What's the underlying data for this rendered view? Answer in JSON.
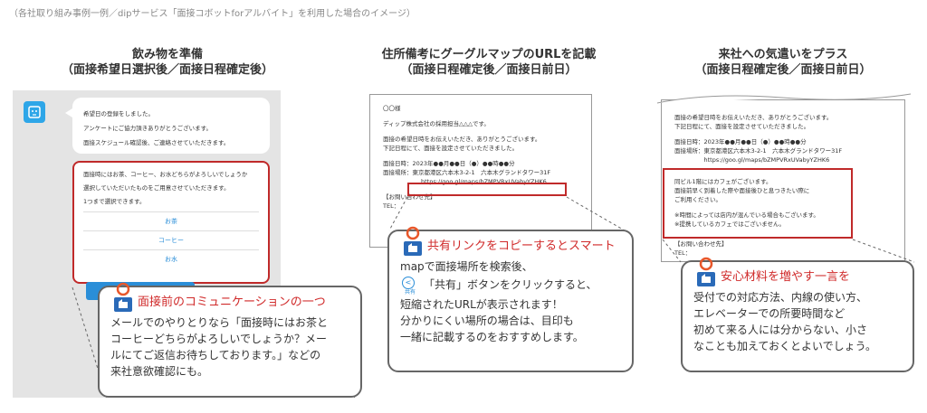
{
  "caption": "（各社取り組み事例一例／dipサービス「面接コボットforアルバイト」を利用した場合のイメージ）",
  "sections": [
    {
      "title1": "飲み物を準備",
      "title2": "（面接希望日選択後／面接日程確定後）"
    },
    {
      "title1": "住所備考にグーグルマップのURLを記載",
      "title2": "（面接日程確定後／面接日前日）"
    },
    {
      "title1": "来社への気遣いをプラス",
      "title2": "（面接日程確定後／面接日前日）"
    }
  ],
  "chat": {
    "bubble1": [
      "希望日の登録をしました。",
      "アンケートにご協力頂きありがとうございます。",
      "面接スケジュール確認後、ご連絡させていただきます。"
    ],
    "bubble2": [
      "面接時にはお茶、コーヒー、お水どちらがよろしいでしょうか",
      "選択していただいたものをご用意させていただきます。",
      "1つまで選択できます。"
    ],
    "options": [
      "お茶",
      "コーヒー",
      "お水"
    ]
  },
  "doc2": {
    "lines": [
      "〇〇様",
      "",
      "ディップ株式会社の採用担当△△△です。",
      "",
      "面接の希望日時をお伝えいただき、ありがとうございます。",
      "下記日程にて、面接を設定させていただきました。",
      "",
      "面接日時：2023年●●月●●日（●）●●時●●分",
      "面接場所：東京都港区六本木3-2-1　六本木グランドタワー31F"
    ],
    "url": "https://goo.gl/maps/bZMPVRxUVabyYZHK6",
    "contact": [
      "【お問い合わせ先】",
      "TEL："
    ]
  },
  "doc3": {
    "lines": [
      "面接の希望日時をお伝えいただき、ありがとうございます。",
      "下記日程にて、面接を設定させていただきました。",
      "",
      "面接日時：2023年●●月●●日（●）●●時●●分",
      "面接場所：東京都港区六本木3-2-1　六本木グランドタワー31F",
      "　　　　　https://goo.gl/maps/bZMPVRxUVabyYZHK6"
    ],
    "box": [
      "同ビル1階にはカフェがございます。",
      "面接前早く到着した際や面接後ひと息つきたい際に",
      "ご利用ください。",
      "",
      "※時間によっては店内が混んでいる場合もございます。",
      "※提携しているカフェではございません。"
    ],
    "contact": [
      "【お問い合わせ先】",
      "TEL："
    ]
  },
  "callout1": {
    "title": "面接前のコミュニケーションの一つ",
    "lines": [
      "メールでのやりとりなら「面接時にはお茶と",
      "コーヒーどちらがよろしいでしょうか？メー",
      "ルにてご返信お待ちしております。」などの",
      "来社意欲確認にも。"
    ]
  },
  "callout2": {
    "title": "共有リンクをコピーするとスマート",
    "line1": "mapで面接場所を検索後、",
    "share_label": "共有",
    "lines": [
      "「共有」ボタンをクリックすると、",
      "短縮されたURLが表示されます！",
      "分かりにくい場所の場合は、目印も",
      "一緒に記載するのをおすすめします。"
    ]
  },
  "callout3": {
    "title": "安心材料を増やす一言を",
    "lines": [
      "受付での対応方法、内線の使い方、",
      "エレベーターでの所要時間など",
      "初めて来る人には分からない、小さ",
      "なことも加えておくとよいでしょう。"
    ]
  },
  "colors": {
    "accent_red": "#c02a2a",
    "accent_blue": "#2a8ed8",
    "bot_blue": "#2ea6e8"
  }
}
